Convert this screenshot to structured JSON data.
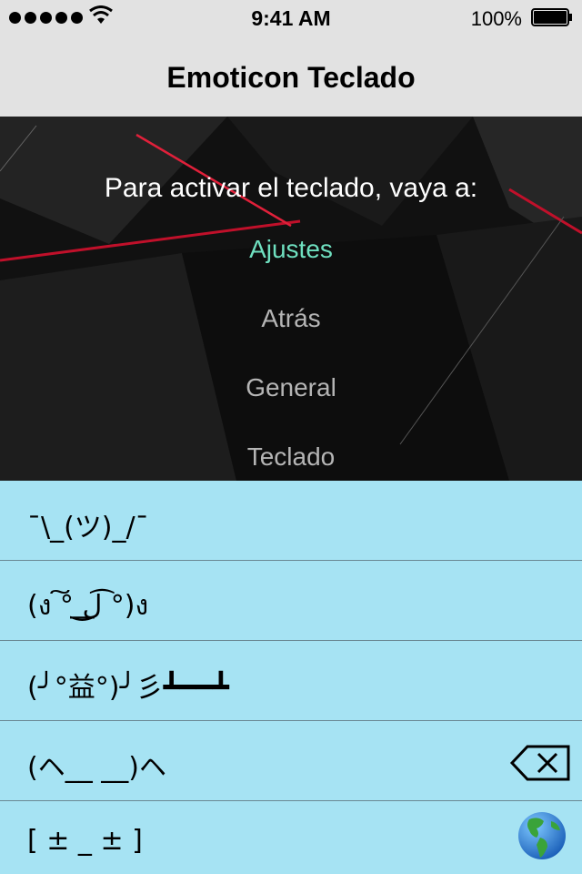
{
  "status_bar": {
    "time": "9:41 AM",
    "battery": "100%"
  },
  "nav": {
    "title": "Emoticon Teclado"
  },
  "hero": {
    "instructions": "Para activar el teclado, vaya a:",
    "steps": [
      "Ajustes",
      "Atrás",
      "General",
      "Teclado"
    ]
  },
  "keyboard": {
    "emoticons": [
      "¯\\_(ツ)_/¯",
      "(ง ͠° ͟ل͜ ͡°)ง",
      "(╯°益°)╯彡┻━━┻",
      "(ヘ__ __)ヘ",
      "[ ± _ ± ]"
    ]
  },
  "colors": {
    "keyboard_bg": "#a6e3f3",
    "active_step": "#6fe0c0",
    "bar_bg": "#e2e2e2"
  }
}
